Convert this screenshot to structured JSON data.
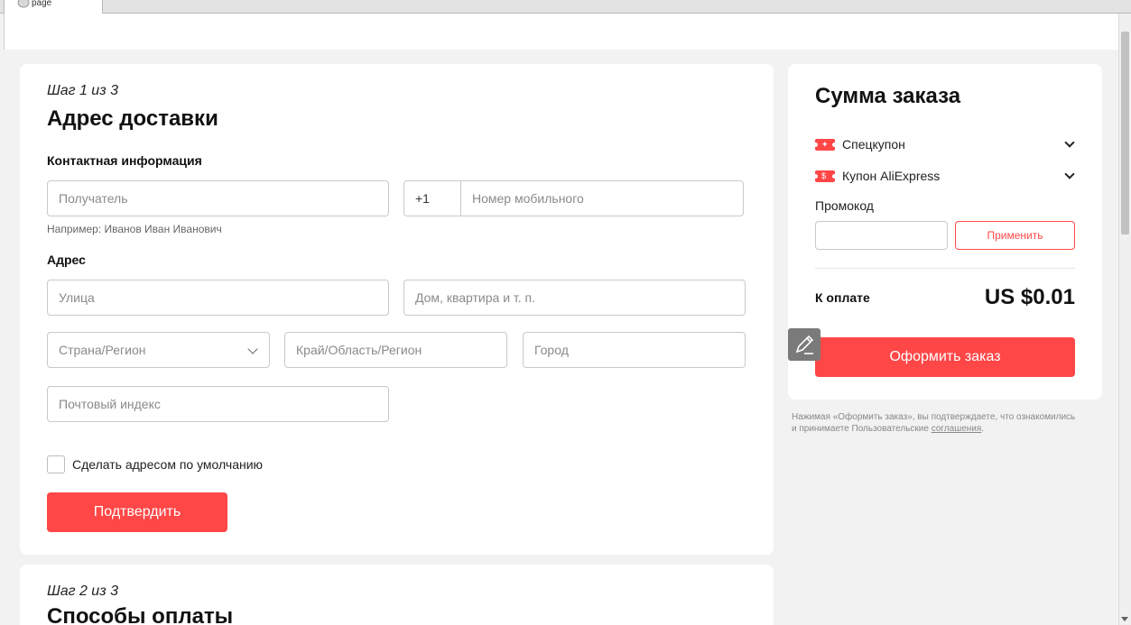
{
  "browser": {
    "tab_title": "page"
  },
  "step1": {
    "step_label": "Шаг 1 из 3",
    "title": "Адрес доставки",
    "contact_label": "Контактная информация",
    "recipient_placeholder": "Получатель",
    "recipient_hint": "Например: Иванов Иван Иванович",
    "phone_code": "+1",
    "phone_placeholder": "Номер мобильного",
    "address_label": "Адрес",
    "street_placeholder": "Улица",
    "house_placeholder": "Дом, квартира и т. п.",
    "country_placeholder": "Страна/Регион",
    "region_placeholder": "Край/Область/Регион",
    "city_placeholder": "Город",
    "zip_placeholder": "Почтовый индекс",
    "default_checkbox_label": "Сделать адресом по умолчанию",
    "confirm_button": "Подтвердить"
  },
  "step2": {
    "step_label": "Шаг 2 из 3",
    "title": "Способы оплаты"
  },
  "summary": {
    "title": "Сумма заказа",
    "coupons": [
      {
        "label": "Спецкупон",
        "icon": "coupon-icon"
      },
      {
        "label": "Купон AliExpress",
        "icon": "dollar-coupon-icon"
      }
    ],
    "promo_label": "Промокод",
    "apply_button": "Применить",
    "pay_label": "К оплате",
    "pay_amount": "US $0.01",
    "checkout_button": "Оформить заказ"
  },
  "disclaimer": {
    "text_1": "Нажимая «Оформить заказ», вы подтверждаете, что ознакомились",
    "text_2": "и принимаете Пользовательские ",
    "link": "соглашения",
    "text_end": "."
  },
  "colors": {
    "accent": "#ff4747",
    "background": "#f2f2f2"
  }
}
